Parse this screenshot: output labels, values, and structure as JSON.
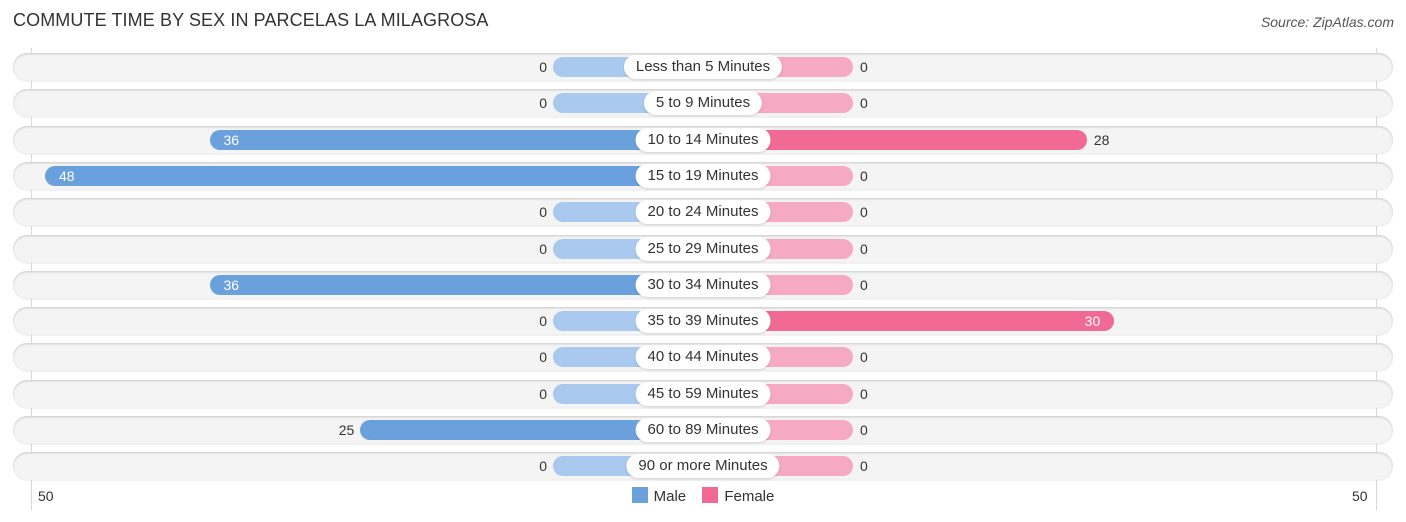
{
  "title": "COMMUTE TIME BY SEX IN PARCELAS LA MILAGROSA",
  "source": "Source: ZipAtlas.com",
  "colors": {
    "male": "#6aa0dc",
    "female": "#f06a95",
    "male_zero": "#a9c9ee",
    "female_zero": "#f6a9c3"
  },
  "chart_data": {
    "type": "bar",
    "orientation": "horizontal-diverging",
    "title": "COMMUTE TIME BY SEX IN PARCELAS LA MILAGROSA",
    "categories": [
      "Less than 5 Minutes",
      "5 to 9 Minutes",
      "10 to 14 Minutes",
      "15 to 19 Minutes",
      "20 to 24 Minutes",
      "25 to 29 Minutes",
      "30 to 34 Minutes",
      "35 to 39 Minutes",
      "40 to 44 Minutes",
      "45 to 59 Minutes",
      "60 to 89 Minutes",
      "90 or more Minutes"
    ],
    "series": [
      {
        "name": "Male",
        "values": [
          0,
          0,
          36,
          48,
          0,
          0,
          36,
          0,
          0,
          0,
          25,
          0
        ]
      },
      {
        "name": "Female",
        "values": [
          0,
          0,
          28,
          0,
          0,
          0,
          0,
          30,
          0,
          0,
          0,
          0
        ]
      }
    ],
    "axis": {
      "min": 0,
      "max": 50,
      "left_tick_label": "50",
      "right_tick_label": "50"
    },
    "legend": {
      "entries": [
        "Male",
        "Female"
      ],
      "position": "bottom-center"
    },
    "grid": false
  }
}
